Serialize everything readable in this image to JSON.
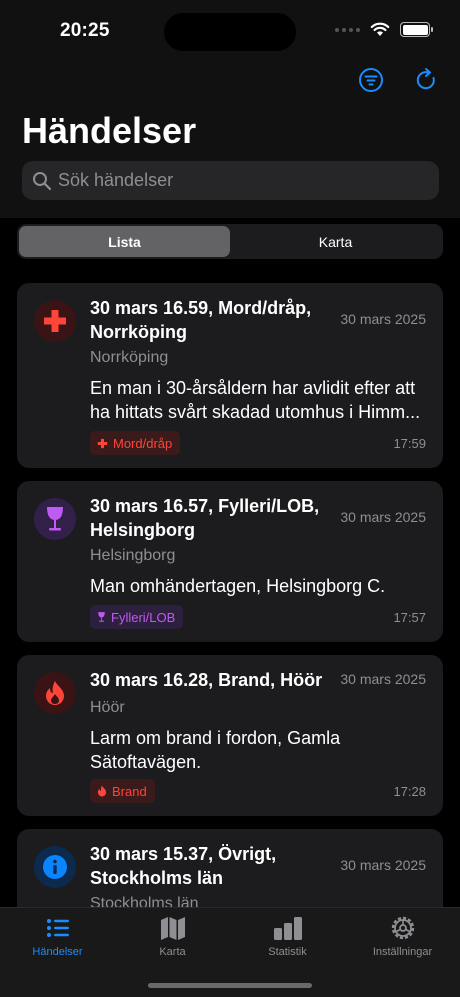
{
  "status": {
    "time": "20:25"
  },
  "header": {
    "title": "Händelser"
  },
  "search": {
    "placeholder": "Sök händelser"
  },
  "segmented": {
    "list": "Lista",
    "map": "Karta",
    "selected": "Lista"
  },
  "events": [
    {
      "title": "30 mars 16.59, Mord/dråp, Norrköping",
      "date": "30 mars 2025",
      "location": "Norrköping",
      "description": "En man i 30-årsåldern har avlidit efter att ha hittats svårt skadad utomhus i Himm...",
      "badge": "Mord/dråp",
      "time": "17:59",
      "icon": "medical-cross-icon",
      "color": "#ff453a"
    },
    {
      "title": "30 mars 16.57, Fylleri/LOB, Helsingborg",
      "date": "30 mars 2025",
      "location": "Helsingborg",
      "description": "Man omhändertagen, Helsingborg C.",
      "badge": "Fylleri/LOB",
      "time": "17:57",
      "icon": "wine-glass-icon",
      "color": "#bf5af2"
    },
    {
      "title": "30 mars 16.28, Brand, Höör",
      "date": "30 mars 2025",
      "location": "Höör",
      "description": "Larm om brand i fordon, Gamla Sätoftavägen.",
      "badge": "Brand",
      "time": "17:28",
      "icon": "flame-icon",
      "color": "#ff453a"
    },
    {
      "title": "30 mars 15.37, Övrigt, Stockholms län",
      "date": "30 mars 2025",
      "location": "Stockholms län",
      "icon": "info-icon",
      "color": "#0a84ff"
    }
  ],
  "tabbar": [
    {
      "label": "Händelser",
      "icon": "list-icon",
      "active": true
    },
    {
      "label": "Karta",
      "icon": "map-icon"
    },
    {
      "label": "Statistik",
      "icon": "bar-chart-icon"
    },
    {
      "label": "Inställningar",
      "icon": "gear-icon"
    }
  ],
  "colors": {
    "accent": "#0a84ff",
    "background": "#000000",
    "card": "#1c1c1e"
  }
}
